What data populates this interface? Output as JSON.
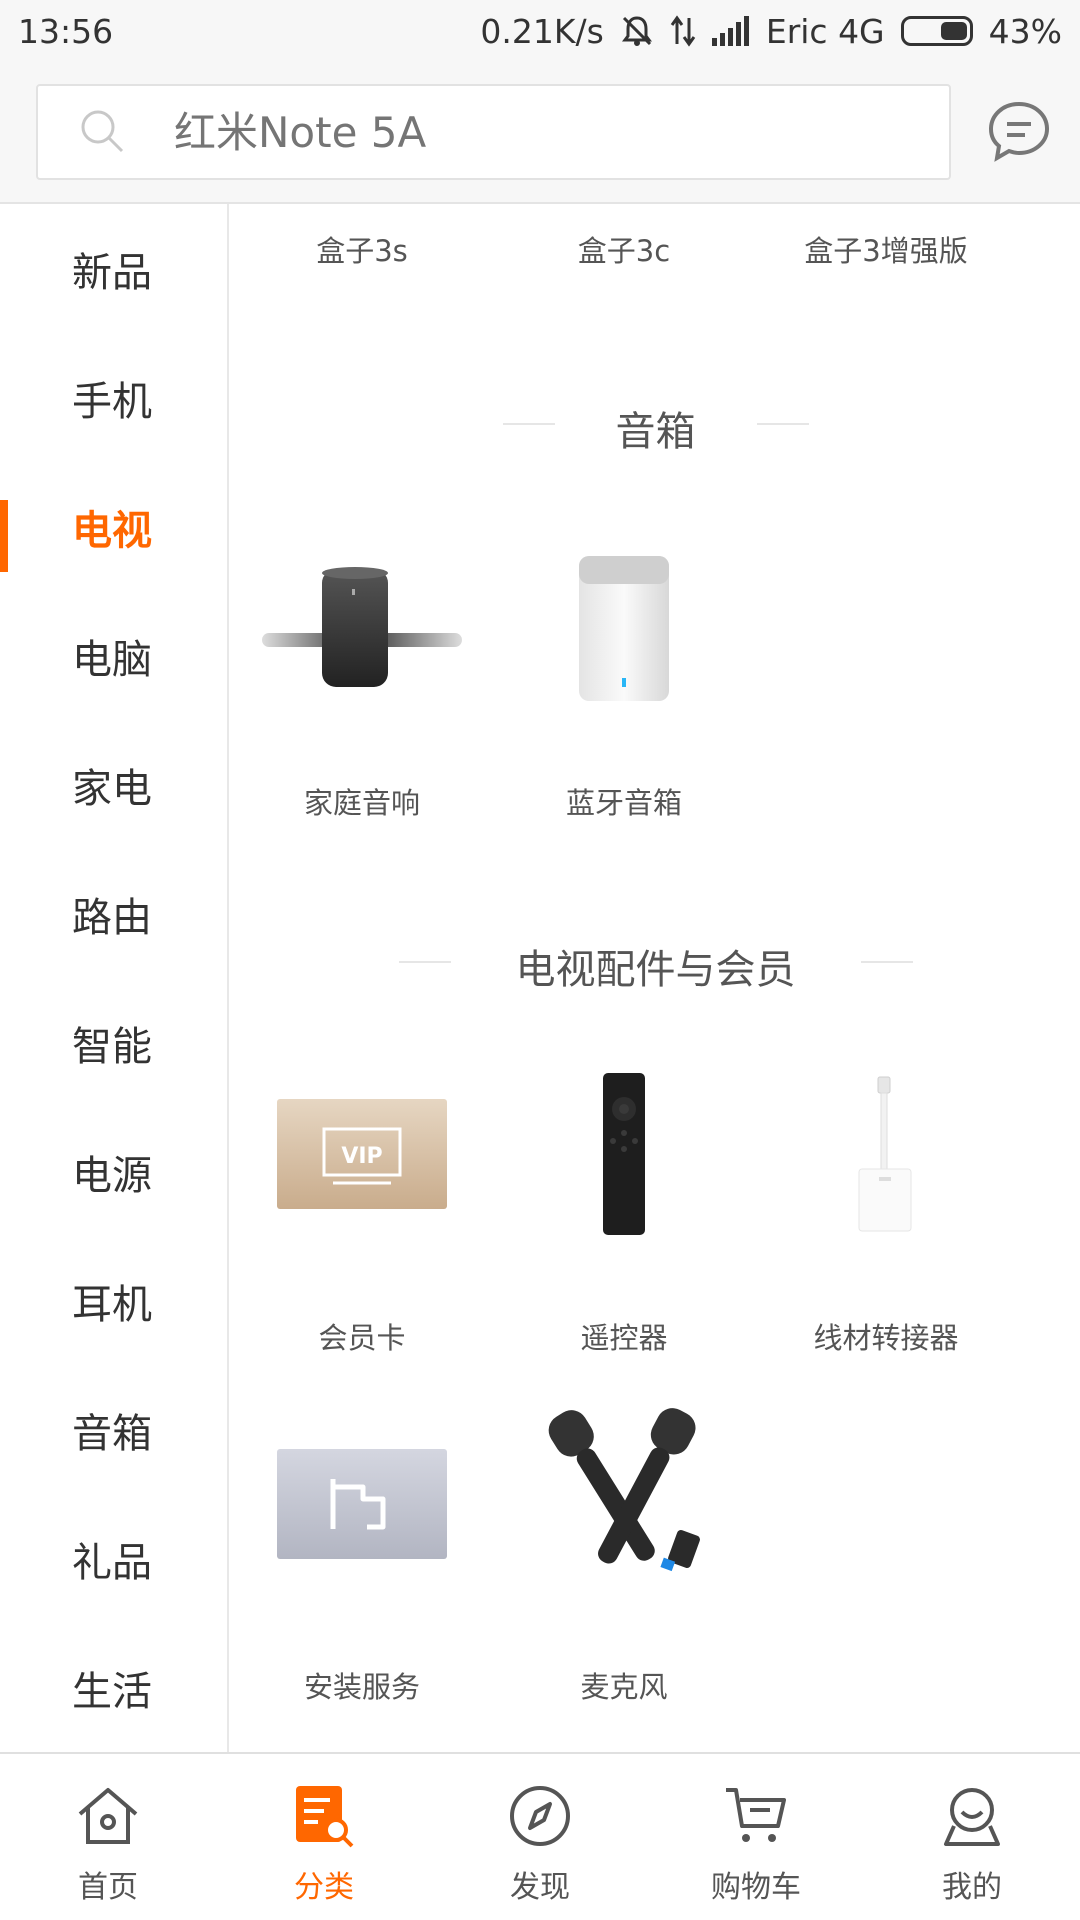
{
  "status_bar": {
    "time": "13:56",
    "speed": "0.21K/s",
    "carrier": "Eric 4G",
    "battery": "43%",
    "battery_level": 0.43
  },
  "search": {
    "placeholder": "红米Note 5A"
  },
  "sidebar": {
    "items": [
      {
        "label": "新品"
      },
      {
        "label": "手机"
      },
      {
        "label": "电视"
      },
      {
        "label": "电脑"
      },
      {
        "label": "家电"
      },
      {
        "label": "路由"
      },
      {
        "label": "智能"
      },
      {
        "label": "电源"
      },
      {
        "label": "耳机"
      },
      {
        "label": "音箱"
      },
      {
        "label": "礼品"
      },
      {
        "label": "生活"
      }
    ],
    "active_index": 2
  },
  "main": {
    "top_row": [
      "盒子3s",
      "盒子3c",
      "盒子3增强版"
    ],
    "sections": [
      {
        "title": "音箱",
        "products": [
          {
            "label": "家庭音响",
            "icon": "home-theater-speaker-image"
          },
          {
            "label": "蓝牙音箱",
            "icon": "bluetooth-speaker-image"
          }
        ]
      },
      {
        "title": "电视配件与会员",
        "products": [
          {
            "label": "会员卡",
            "icon": "vip-card-image"
          },
          {
            "label": "遥控器",
            "icon": "remote-control-image"
          },
          {
            "label": "线材转接器",
            "icon": "cable-adapter-image"
          },
          {
            "label": "安装服务",
            "icon": "installation-service-image"
          },
          {
            "label": "麦克风",
            "icon": "microphone-image"
          }
        ]
      }
    ],
    "vip_text": "VIP"
  },
  "bottom_nav": {
    "items": [
      {
        "label": "首页",
        "icon": "home-icon"
      },
      {
        "label": "分类",
        "icon": "category-icon"
      },
      {
        "label": "发现",
        "icon": "compass-icon"
      },
      {
        "label": "购物车",
        "icon": "cart-icon"
      },
      {
        "label": "我的",
        "icon": "profile-icon"
      }
    ],
    "active_index": 1
  },
  "colors": {
    "accent": "#ff6700",
    "text": "#333333",
    "muted": "#999999"
  }
}
